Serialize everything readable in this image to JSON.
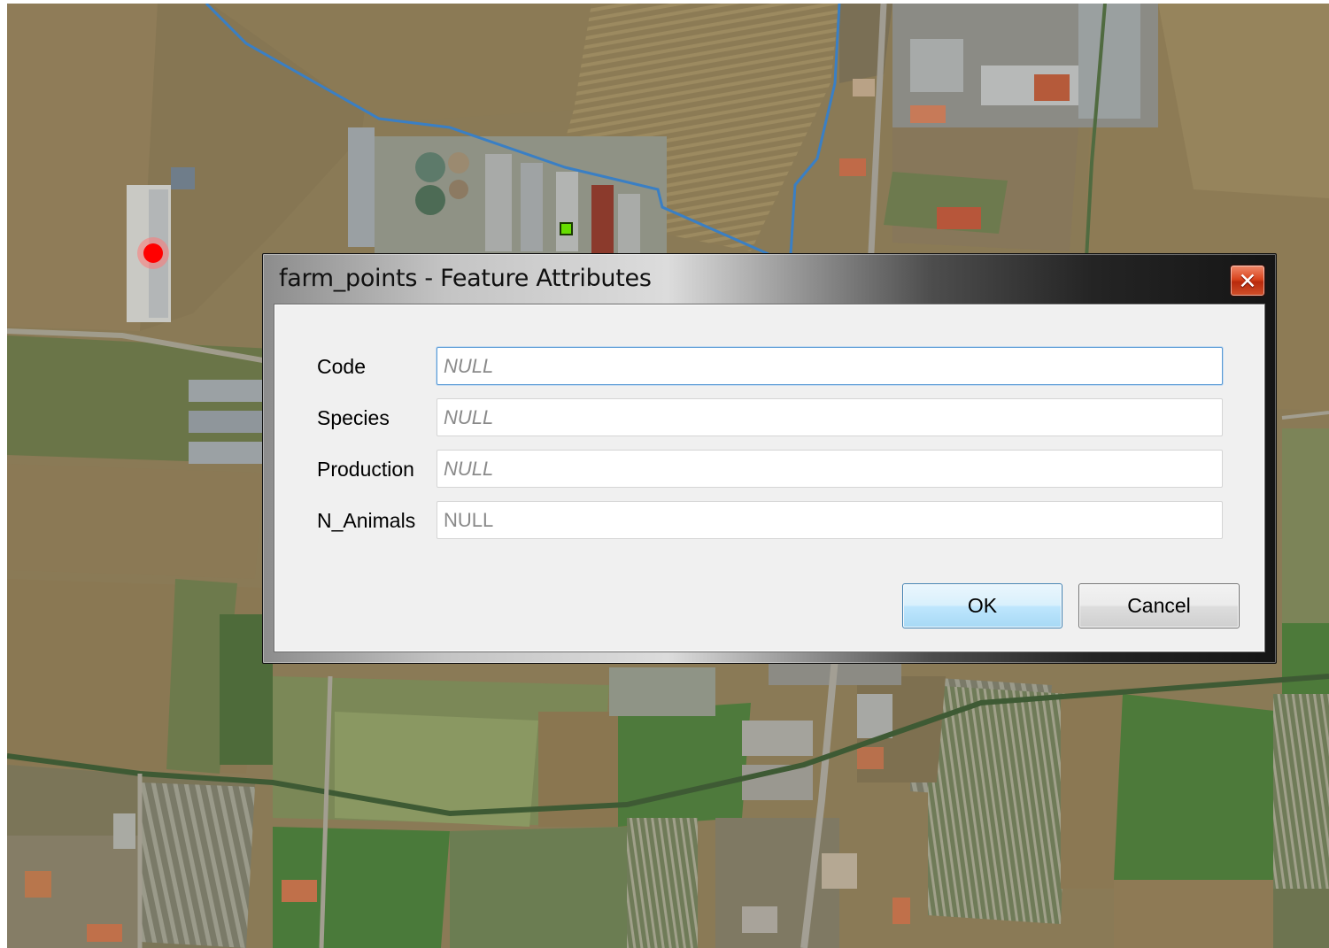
{
  "dialog": {
    "title": "farm_points - Feature Attributes",
    "close_label": "✕"
  },
  "fields": [
    {
      "label": "Code",
      "placeholder": "NULL"
    },
    {
      "label": "Species",
      "placeholder": "NULL"
    },
    {
      "label": "Production",
      "placeholder": "NULL"
    },
    {
      "label": "N_Animals",
      "placeholder": "NULL"
    }
  ],
  "buttons": {
    "ok": "OK",
    "cancel": "Cancel"
  },
  "map": {
    "point_marker_color": "#ff0000",
    "vertex_marker_color": "#66dd00",
    "stream_color": "#3a7fc4"
  }
}
